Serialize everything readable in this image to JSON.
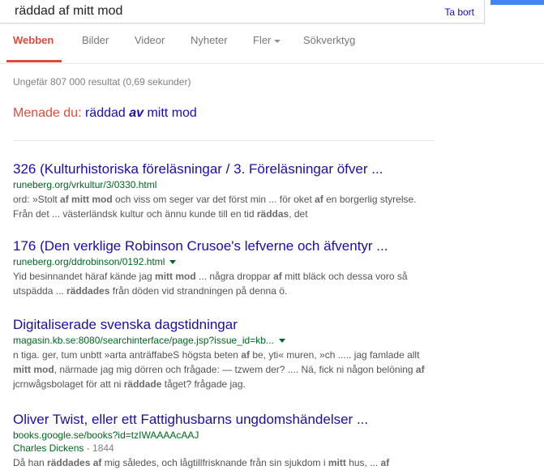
{
  "search": {
    "query": "räddad af mitt mod",
    "clear_label": "Ta bort"
  },
  "tabs": [
    {
      "label": "Webben"
    },
    {
      "label": "Bilder"
    },
    {
      "label": "Videor"
    },
    {
      "label": "Nyheter"
    },
    {
      "label": "Fler"
    },
    {
      "label": "Sökverktyg"
    }
  ],
  "stats": "Ungefär 807 000 resultat (0,69 sekunder)",
  "did_you_mean": {
    "label": "Menade du:",
    "pre": "räddad ",
    "emph": "av",
    "post": " mitt mod"
  },
  "results": [
    {
      "title": "326 (Kulturhistoriska föreläsningar / 3. Föreläsningar öfver ...",
      "url": "runeberg.org/vrkultur/3/0330.html",
      "snippet_html": "ord: »Stolt <b>af mitt mod</b> och viss om seger var det först min ... för oket <b>af</b> en borgerlig styrelse. Från det ... västerländsk kultur och ännu kunde till en tid <b>räddas</b>, det"
    },
    {
      "title": "176 (Den verklige Robinson Crusoe's lefverne och äfventyr ...",
      "url": "runeberg.org/ddrobinson/0192.html",
      "snippet_html": "Yid besinnandet häraf kände jag <b>mitt mod</b> ... några droppar <b>af</b> mitt bläck och dessa voro så utspädda ... <b>räddades</b> från döden vid strandningen på denna ö."
    },
    {
      "title": "Digitaliserade svenska dagstidningar",
      "url": "magasin.kb.se:8080/searchinterface/page.jsp?issue_id=kb...",
      "snippet_html": "n tiga. ger, tum unbtt »arta anträffabeS högsta beten <b>af</b> be, yti« muren, »ch ..... jag famlade allt <b>mitt mod</b>, närmade jag mig dörren och frågade: — tzwem der? .... Nä, fick ni någon belöning <b>af</b> jcrnwågsbolaget för att ni <b>räddade</b> tåget? frågade jag."
    },
    {
      "title": "Oliver Twist, eller ett Fattighusbarns ungdomshändelser ...",
      "url": "books.google.se/books?id=tzIWAAAAcAAJ",
      "author": "Charles Dickens",
      "year": " - 1844",
      "snippet_html": "Då han <b>räddades af</b> mig således, och lågtillfrisknande från sin sjukdom i <b>mitt</b> hus, ... <b>af</b>"
    }
  ]
}
